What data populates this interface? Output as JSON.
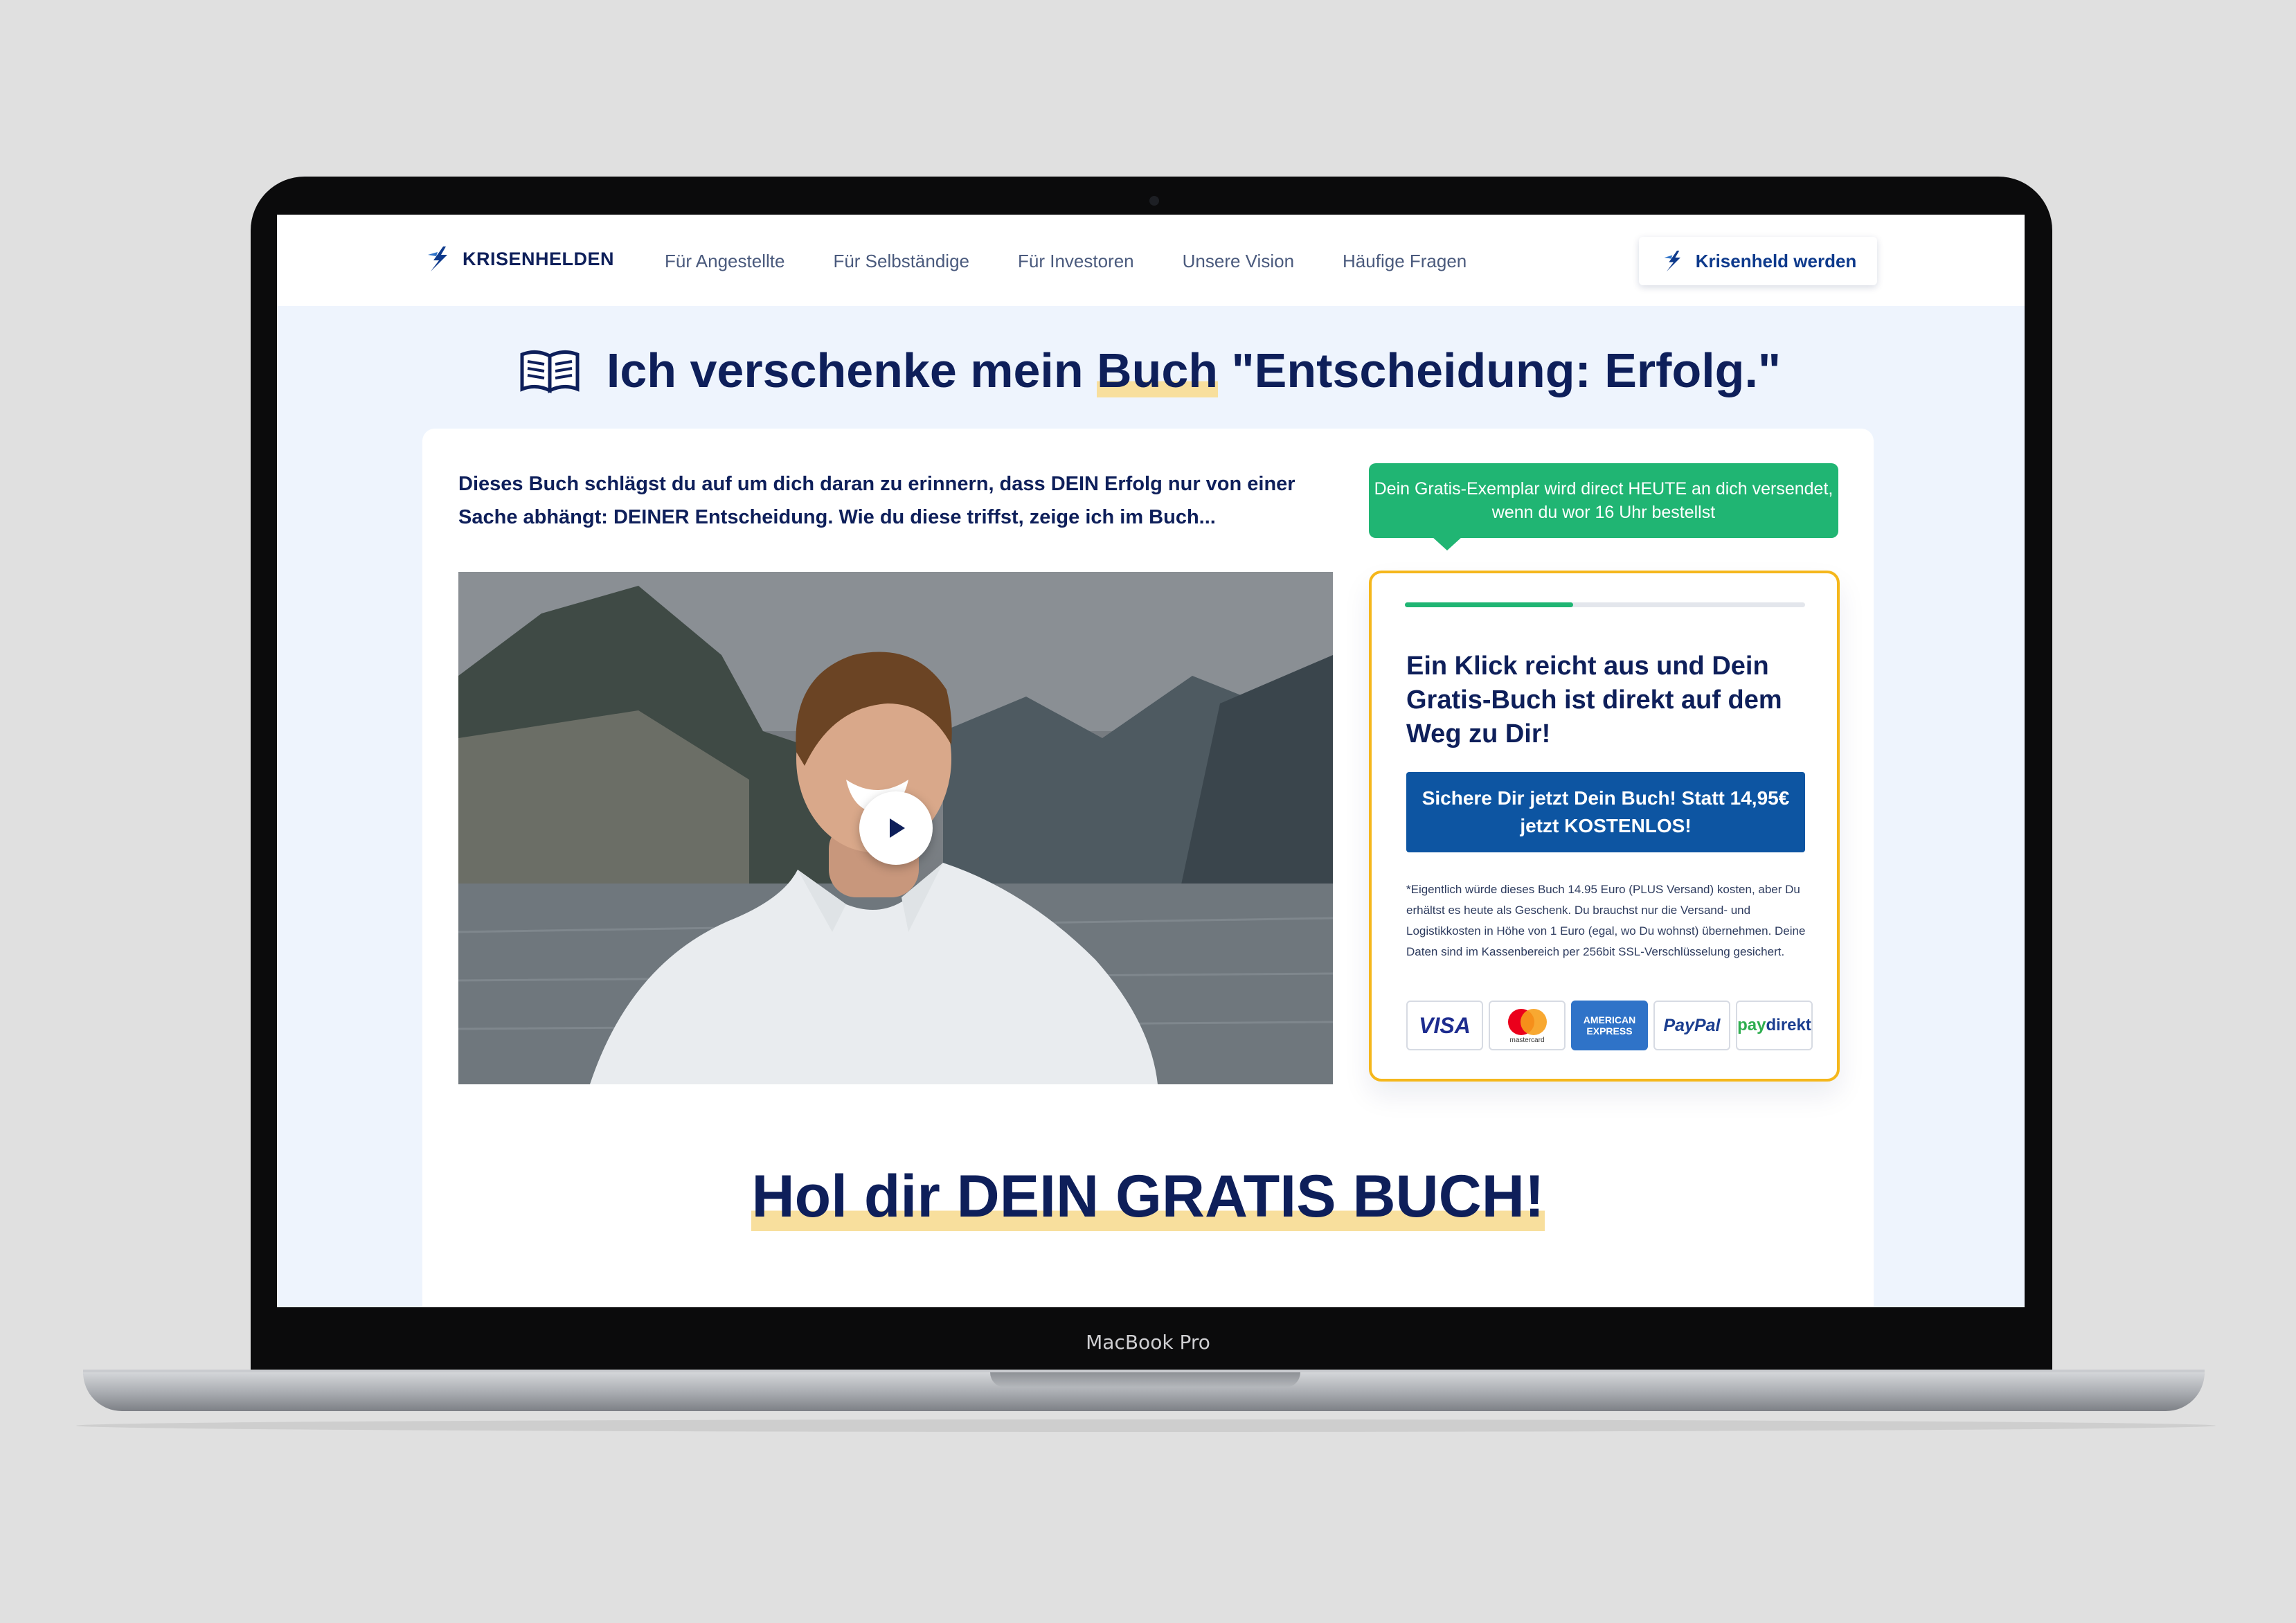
{
  "device": {
    "label": "MacBook Pro"
  },
  "navbar": {
    "logo_text": "KRISENHELDEN",
    "links": [
      "Für Angestellte",
      "Für Selbständige",
      "Für Investoren",
      "Unsere Vision",
      "Häufige Fragen"
    ],
    "cta_label": "Krisenheld werden"
  },
  "hero": {
    "title_before": "Ich verschenke mein ",
    "title_highlight": "Buch",
    "title_after": " \"Entscheidung: Erfolg.\"",
    "intro": "Dieses Buch schlägst du auf um dich daran zu erinnern, dass DEIN Erfolg nur von einer Sache abhängt: DEINER Entscheidung. Wie du diese triffst, zeige ich im Buch..."
  },
  "order": {
    "bubble_text": "Dein Gratis-Exemplar wird direct HEUTE an dich versendet, wenn du wor 16 Uhr bestellst",
    "progress": 0.42,
    "title": "Ein Klick reicht aus und Dein Gratis-Buch ist direkt auf dem Weg zu Dir!",
    "button_label": "Sichere Dir jetzt Dein Buch! Statt 14,95€ jetzt KOSTENLOS!",
    "disclaimer": "*Eigentlich würde dieses Buch 14.95 Euro (PLUS Versand) kosten, aber Du erhältst es heute als Geschenk. Du brauchst nur die Versand- und Logistikkosten in Höhe von 1 Euro (egal, wo Du wohnst) übernehmen. Deine Daten sind im Kassenbereich per 256bit SSL-Verschlüsselung gesichert.",
    "payments": {
      "visa": "VISA",
      "mastercard": "mastercard",
      "amex_line1": "AMERICAN",
      "amex_line2": "EXPRESS",
      "paypal": "PayPal",
      "paydirekt_a": "pay",
      "paydirekt_b": "direkt"
    }
  },
  "section": {
    "title": "Hol dir DEIN GRATIS BUCH!"
  },
  "colors": {
    "navy": "#0e1f5a",
    "green": "#20b573",
    "blue": "#0d55a2",
    "yellow": "#f5b71c",
    "highlight": "#f8df9d"
  }
}
